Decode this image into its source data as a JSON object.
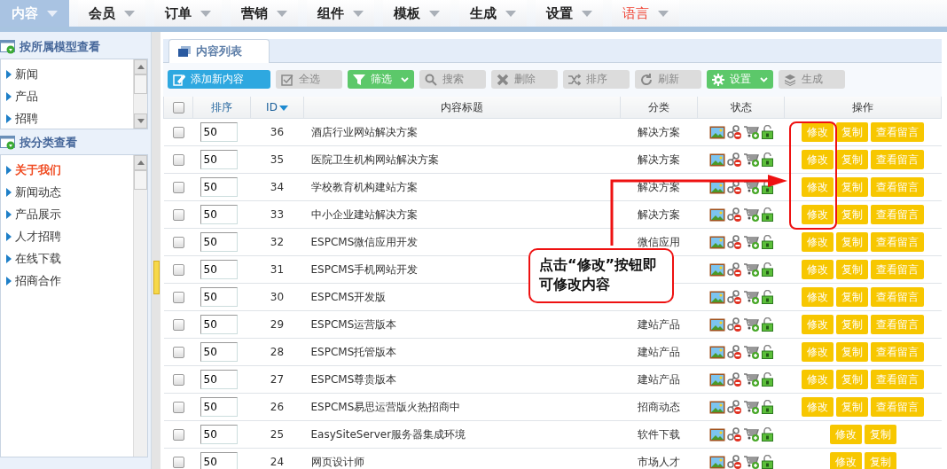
{
  "nav": [
    {
      "label": "内容",
      "selected": true,
      "highlighted": false
    },
    {
      "label": "会员",
      "selected": false,
      "highlighted": false
    },
    {
      "label": "订单",
      "selected": false,
      "highlighted": false
    },
    {
      "label": "营销",
      "selected": false,
      "highlighted": false
    },
    {
      "label": "组件",
      "selected": false,
      "highlighted": false
    },
    {
      "label": "模板",
      "selected": false,
      "highlighted": false
    },
    {
      "label": "生成",
      "selected": false,
      "highlighted": false
    },
    {
      "label": "设置",
      "selected": false,
      "highlighted": false
    },
    {
      "label": "语言",
      "selected": false,
      "highlighted": true
    }
  ],
  "sidebar": {
    "sections": [
      {
        "title": "按所属模型查看",
        "items": [
          {
            "label": "新闻",
            "selected": false
          },
          {
            "label": "产品",
            "selected": false
          },
          {
            "label": "招聘",
            "selected": false
          }
        ]
      },
      {
        "title": "按分类查看",
        "items": [
          {
            "label": "关于我们",
            "selected": true
          },
          {
            "label": "新闻动态",
            "selected": false
          },
          {
            "label": "产品展示",
            "selected": false
          },
          {
            "label": "人才招聘",
            "selected": false
          },
          {
            "label": "在线下载",
            "selected": false
          },
          {
            "label": "招商合作",
            "selected": false
          }
        ]
      }
    ]
  },
  "panel_tab": {
    "label": "内容列表"
  },
  "toolbar": [
    {
      "label": "添加新内容",
      "kind": "primary",
      "dropdown": false
    },
    {
      "label": "全选",
      "kind": "plain",
      "dropdown": false
    },
    {
      "label": "筛选",
      "kind": "success",
      "dropdown": true
    },
    {
      "label": "搜索",
      "kind": "plain",
      "dropdown": false
    },
    {
      "label": "删除",
      "kind": "plain",
      "dropdown": false
    },
    {
      "label": "排序",
      "kind": "plain",
      "dropdown": false
    },
    {
      "label": "刷新",
      "kind": "plain",
      "dropdown": false
    },
    {
      "label": "设置",
      "kind": "success",
      "dropdown": true
    },
    {
      "label": "生成",
      "kind": "plain",
      "dropdown": false
    }
  ],
  "table": {
    "select_all": {
      "checked": false
    },
    "columns": [
      "排序",
      "ID",
      "内容标题",
      "分类",
      "状态",
      "操作"
    ],
    "rows": [
      {
        "checked": false,
        "order": "50",
        "id": "36",
        "title": "酒店行业网站解决方案",
        "category": "解决方案",
        "actions": [
          "修改",
          "复制",
          "查看留言"
        ]
      },
      {
        "checked": false,
        "order": "50",
        "id": "35",
        "title": "医院卫生机构网站解决方案",
        "category": "解决方案",
        "actions": [
          "修改",
          "复制",
          "查看留言"
        ]
      },
      {
        "checked": false,
        "order": "50",
        "id": "34",
        "title": "学校教育机构建站方案",
        "category": "解决方案",
        "actions": [
          "修改",
          "复制",
          "查看留言"
        ]
      },
      {
        "checked": false,
        "order": "50",
        "id": "33",
        "title": "中小企业建站解决方案",
        "category": "解决方案",
        "actions": [
          "修改",
          "复制",
          "查看留言"
        ]
      },
      {
        "checked": false,
        "order": "50",
        "id": "32",
        "title": "ESPCMS微信应用开发",
        "category": "微信应用",
        "actions": [
          "修改",
          "复制",
          "查看留言"
        ]
      },
      {
        "checked": false,
        "order": "50",
        "id": "31",
        "title": "ESPCMS手机网站开发",
        "actions": [
          "修改",
          "复制",
          "查看留言"
        ]
      },
      {
        "checked": false,
        "order": "50",
        "id": "30",
        "title": "ESPCMS开发版",
        "actions": [
          "修改",
          "复制",
          "查看留言"
        ]
      },
      {
        "checked": false,
        "order": "50",
        "id": "29",
        "title": "ESPCMS运营版本",
        "category": "建站产品",
        "actions": [
          "修改",
          "复制",
          "查看留言"
        ]
      },
      {
        "checked": false,
        "order": "50",
        "id": "28",
        "title": "ESPCMS托管版本",
        "category": "建站产品",
        "actions": [
          "修改",
          "复制",
          "查看留言"
        ]
      },
      {
        "checked": false,
        "order": "50",
        "id": "27",
        "title": "ESPCMS尊贵版本",
        "category": "建站产品",
        "actions": [
          "修改",
          "复制",
          "查看留言"
        ]
      },
      {
        "checked": false,
        "order": "50",
        "id": "26",
        "title": "ESPCMS易思运营版火热招商中",
        "category": "招商动态",
        "actions": [
          "修改",
          "复制",
          "查看留言"
        ]
      },
      {
        "checked": false,
        "order": "50",
        "id": "25",
        "title": "EasySiteServer服务器集成环境",
        "category": "软件下载",
        "actions": [
          "修改",
          "复制"
        ]
      },
      {
        "checked": false,
        "order": "50",
        "id": "24",
        "title": "网页设计师",
        "category": "市场人才",
        "actions": [
          "修改",
          "复制"
        ]
      }
    ]
  },
  "annotation": {
    "text": "点击“修改”按钮即可修改内容"
  }
}
